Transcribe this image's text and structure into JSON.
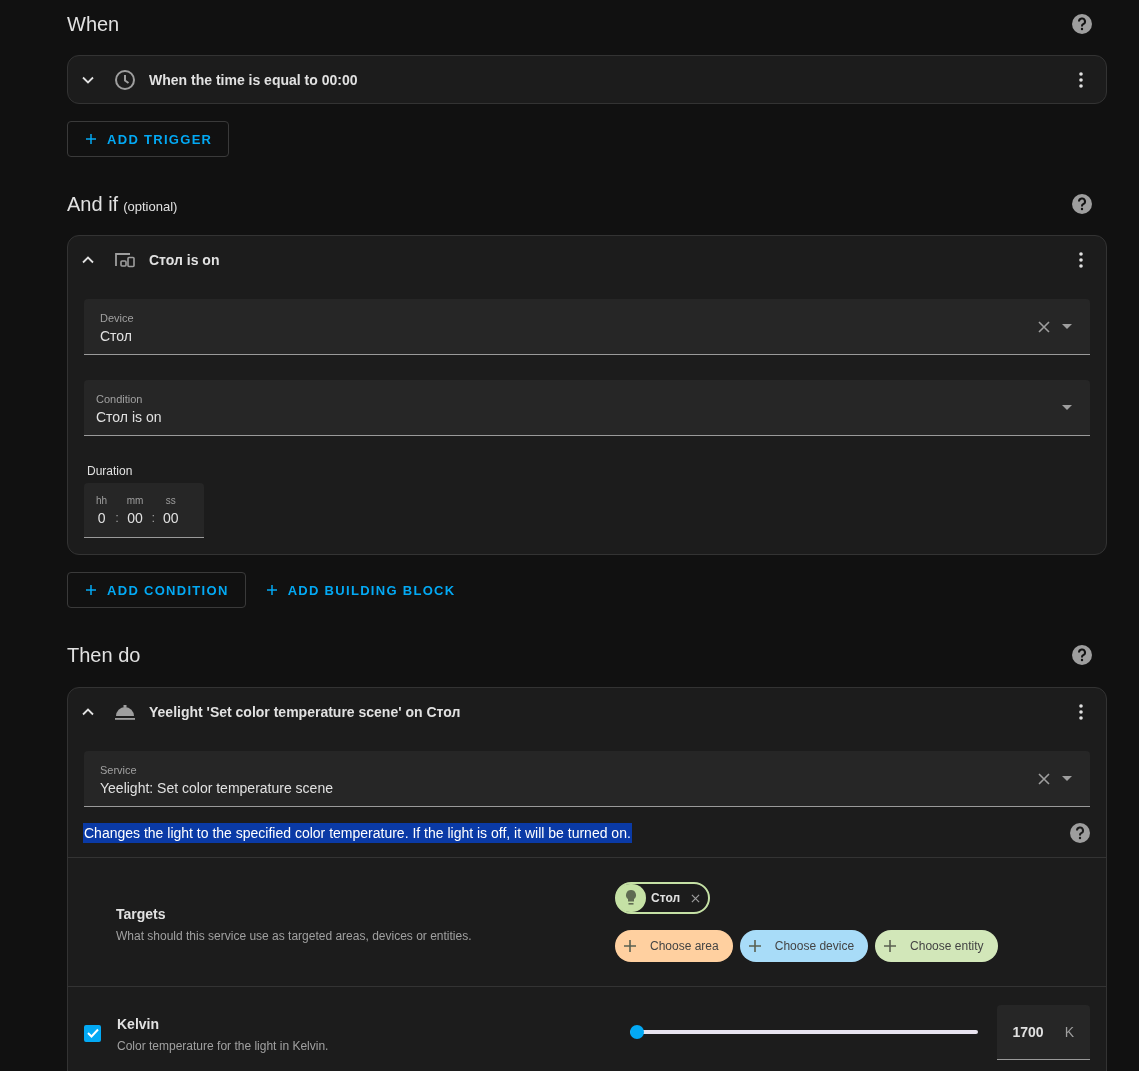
{
  "when": {
    "title": "When",
    "trigger": {
      "title": "When the time is equal to 00:00",
      "expanded": false
    },
    "add_button": "ADD TRIGGER"
  },
  "and_if": {
    "title": "And if",
    "subtitle": "(optional)",
    "condition": {
      "title": "Стол is on",
      "expanded": true,
      "fields": [
        {
          "label": "Device",
          "value": "Стол",
          "clearable": true
        },
        {
          "label": "Condition",
          "value": "Стол is on",
          "clearable": false
        }
      ],
      "duration": {
        "label": "Duration",
        "separator": ":",
        "parts": [
          {
            "label": "hh",
            "value": "0"
          },
          {
            "label": "mm",
            "value": "00"
          },
          {
            "label": "ss",
            "value": "00"
          }
        ]
      }
    },
    "buttons": [
      {
        "label": "ADD CONDITION",
        "outlined": true
      },
      {
        "label": "ADD BUILDING BLOCK",
        "outlined": false
      }
    ]
  },
  "then_do": {
    "title": "Then do",
    "action": {
      "title": "Yeelight 'Set color temperature scene' on Стол",
      "expanded": true,
      "service": {
        "label": "Service",
        "value": "Yeelight: Set color temperature scene",
        "clearable": true
      },
      "description": {
        "text": "Changes the light to the specified color temperature. If the light is off, it will be turned on.",
        "text_selected": true
      },
      "targets": {
        "title": "Targets",
        "description": "What should this service use as targeted areas, devices or entities.",
        "chips": [
          {
            "label": "Стол",
            "color": "#c5e1a5"
          }
        ],
        "pickers": [
          {
            "label": "Choose area",
            "color": "#ffd0a0"
          },
          {
            "label": "Choose device",
            "color": "#a8dcf8"
          },
          {
            "label": "Choose entity",
            "color": "#d2e7b9"
          }
        ]
      },
      "params": [
        {
          "name": "Kelvin",
          "description": "Color temperature for the light in Kelvin.",
          "checked": true,
          "level": 0,
          "value": "1700",
          "unit": "K"
        }
      ]
    }
  }
}
